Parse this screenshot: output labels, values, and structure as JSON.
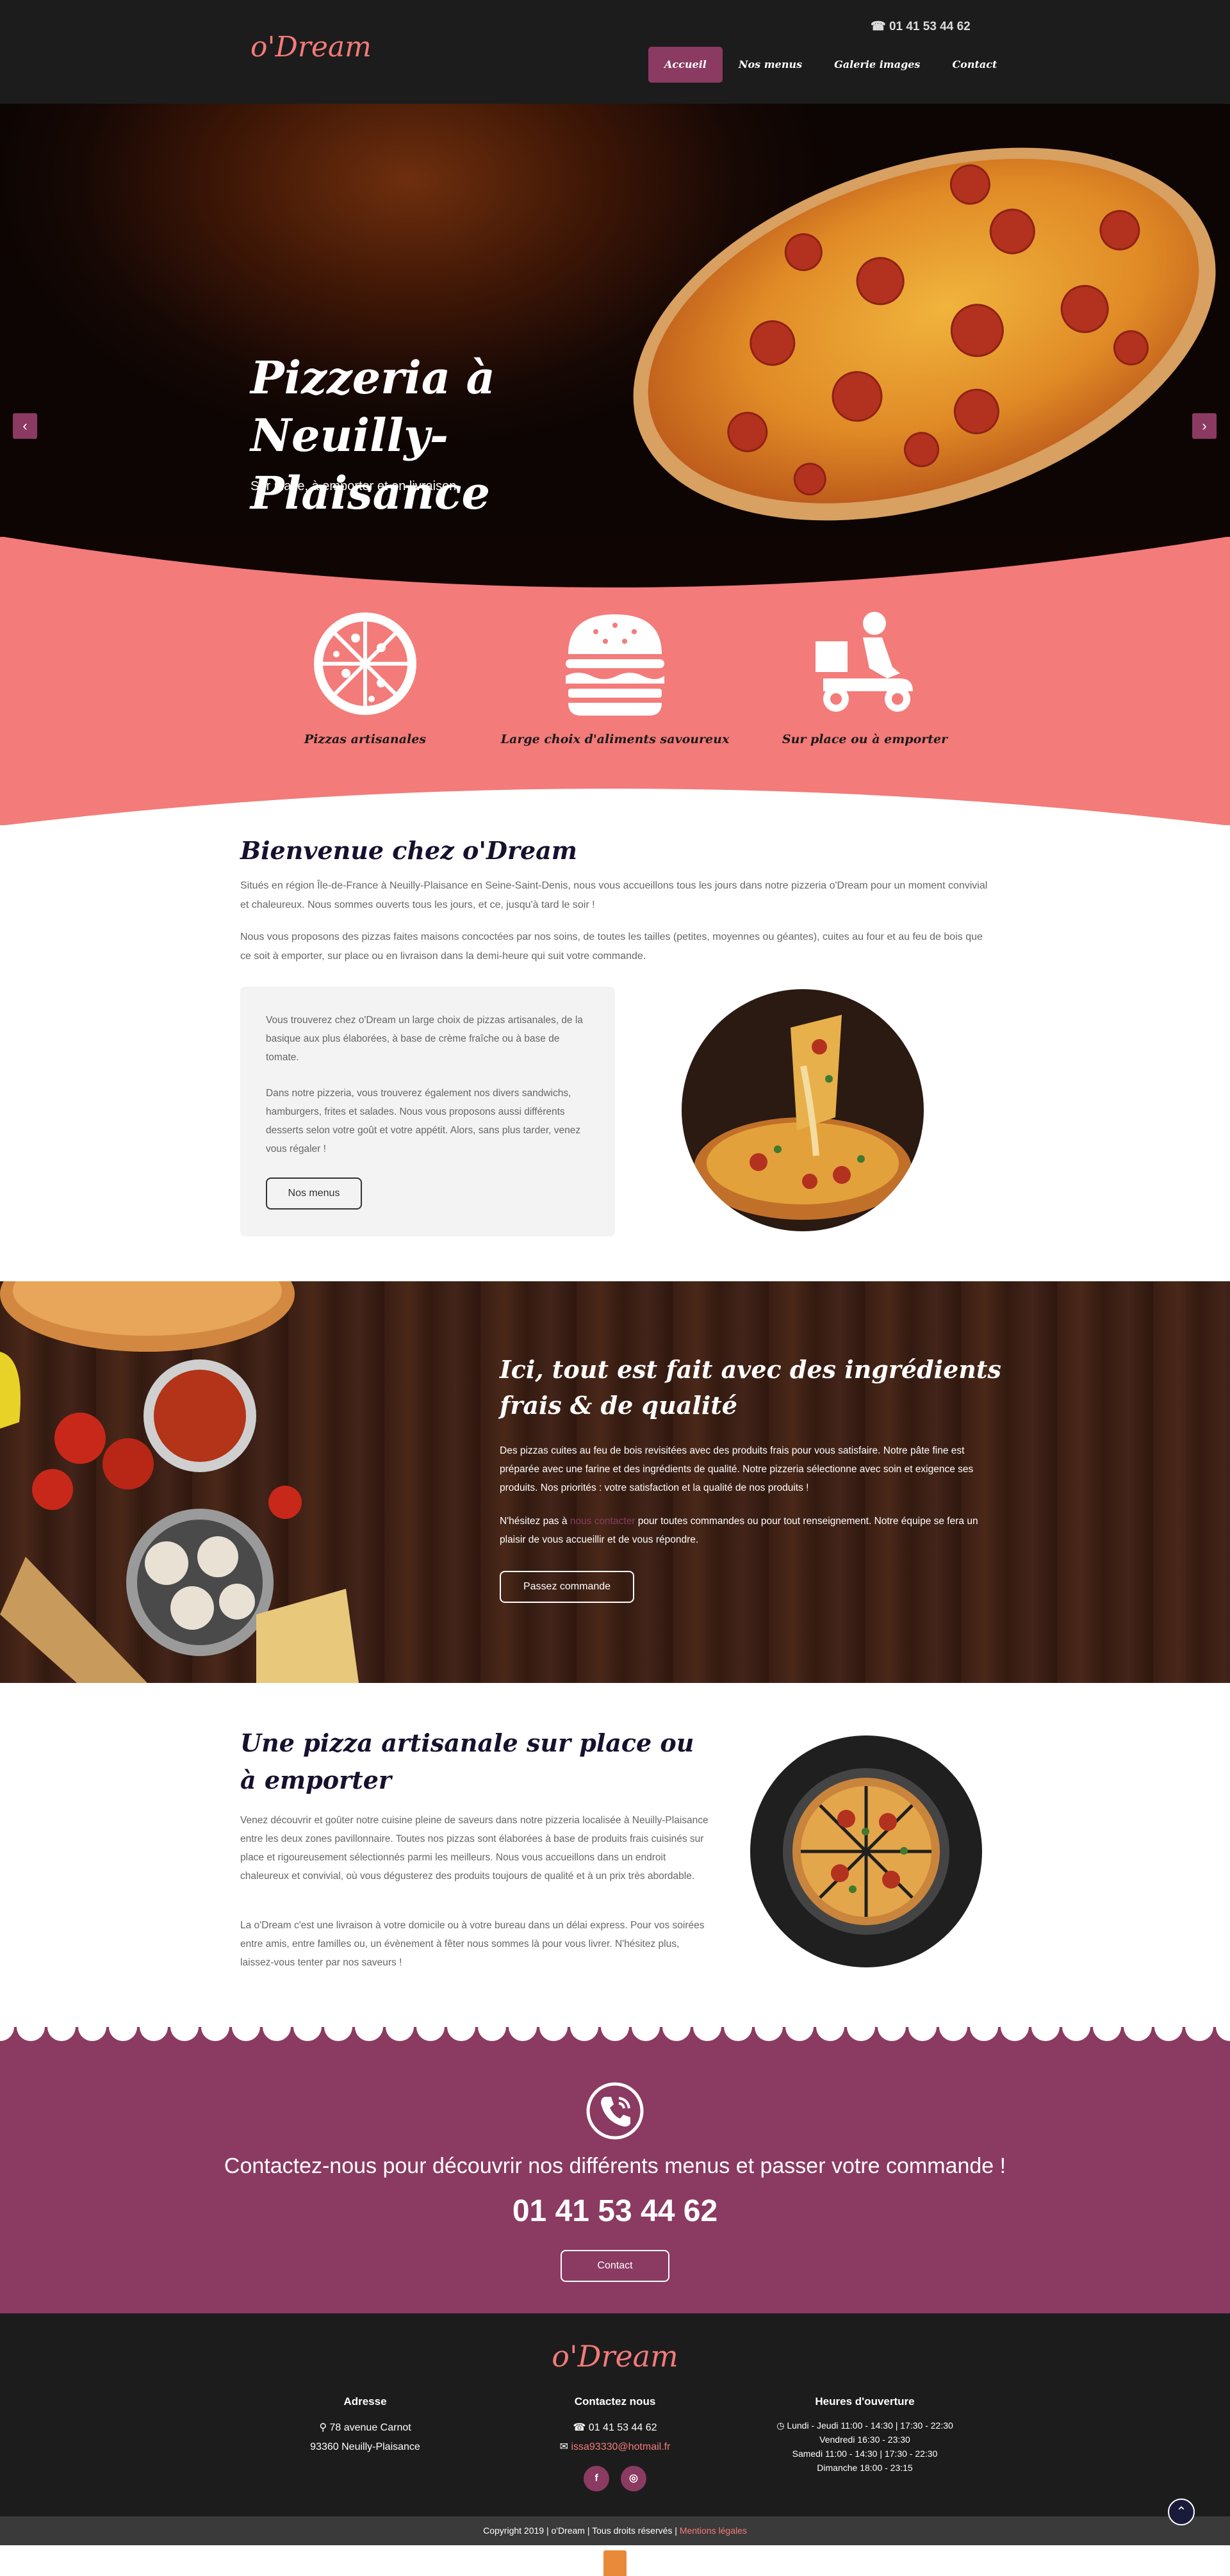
{
  "header": {
    "logo": "o'Dream",
    "phone": "☎ 01 41 53 44 62",
    "nav": [
      {
        "label": "Accueil",
        "active": true
      },
      {
        "label": "Nos menus",
        "active": false
      },
      {
        "label": "Galerie images",
        "active": false
      },
      {
        "label": "Contact",
        "active": false
      }
    ]
  },
  "hero": {
    "title": "Pizzeria à Neuilly-Plaisance",
    "subtitle": "Sur place, à emporter et en livraison",
    "prev": "‹",
    "next": "›"
  },
  "features": [
    {
      "label": "Pizzas artisanales",
      "icon": "pizza-icon"
    },
    {
      "label": "Large choix d'aliments savoureux",
      "icon": "burger-icon"
    },
    {
      "label": "Sur place ou à emporter",
      "icon": "delivery-scooter-icon"
    }
  ],
  "welcome": {
    "title": "Bienvenue chez o'Dream",
    "p1": "Situés en région Île-de-France à Neuilly-Plaisance en Seine-Saint-Denis, nous vous accueillons tous les jours dans notre pizzeria o'Dream pour un moment convivial et chaleureux. Nous sommes ouverts tous les jours, et ce, jusqu'à tard le soir !",
    "p2": "Nous vous proposons des pizzas faites maisons concoctées par nos soins, de toutes les tailles (petites, moyennes ou géantes), cuites au four et au feu de bois que ce soit à emporter, sur place ou en livraison dans la demi-heure qui suit votre commande.",
    "box_p1": "Vous trouverez chez o'Dream un large choix de pizzas artisanales, de la basique aux plus élaborées, à base de crème fraîche ou à base de tomate.",
    "box_p2": "Dans notre pizzeria, vous trouverez également nos divers sandwichs, hamburgers, frites et salades. Nous vous proposons aussi différents desserts selon votre goût et votre appétit. Alors, sans plus tarder, venez vous régaler !",
    "button": "Nos menus"
  },
  "ingredients": {
    "title": "Ici, tout est fait avec des ingrédients frais & de qualité",
    "p1": "Des pizzas cuites au feu de bois revisitées avec des produits frais pour vous satisfaire. Notre pâte fine est préparée avec une farine et des ingrédients de qualité. Notre pizzeria sélectionne avec soin et exigence ses produits. Nos priorités : votre satisfaction et la qualité de nos produits !",
    "p2_before": "N'hésitez pas à ",
    "p2_link": "nous contacter",
    "p2_after": " pour toutes commandes ou pour tout renseignement. Notre équipe se fera un plaisir de vous accueillir et de vous répondre.",
    "button": "Passez commande"
  },
  "artisanale": {
    "title": "Une pizza artisanale sur place ou à emporter",
    "p1": "Venez découvrir et goûter notre cuisine pleine de saveurs dans notre pizzeria localisée à Neuilly-Plaisance entre les deux zones pavillonnaire. Toutes nos pizzas sont élaborées à base de produits frais cuisinés sur place et rigoureusement sélectionnés parmi les meilleurs. Nous vous accueillons dans un endroit chaleureux et convivial, où vous dégusterez des produits toujours de qualité et à un prix très abordable.",
    "p2": "La o'Dream c'est une livraison à votre domicile ou à votre bureau dans un délai express. Pour vos soirées entre amis, entre familles ou, un évènement à fêter nous sommes là pour vous livrer. N'hésitez plus, laissez-vous tenter par nos saveurs !"
  },
  "contact": {
    "text": "Contactez-nous pour découvrir nos différents menus et passer votre commande !",
    "phone": "01 41 53 44 62",
    "button": "Contact"
  },
  "footer": {
    "logo": "o'Dream",
    "address": {
      "title": "Adresse",
      "line1": "78 avenue Carnot",
      "line2": "93360 Neuilly-Plaisance"
    },
    "contact": {
      "title": "Contactez nous",
      "phone": "01 41 53 44 62",
      "email": "issa93330@hotmail.fr",
      "facebook": "f",
      "instagram": "◎"
    },
    "hours": {
      "title": "Heures d'ouverture",
      "lines": [
        "Lundi - Jeudi 11:00 - 14:30 | 17:30 - 22:30",
        "Vendredi 16:30 - 23:30",
        "Samedi 11:00 - 14:30 | 17:30 - 22:30",
        "Dimanche 18:00 - 23:15"
      ]
    },
    "copyright": "Copyright 2019 | o'Dream | Tous droits réservés | ",
    "legal": "Mentions légales",
    "scroll_top": "⌃"
  },
  "colors": {
    "accent": "#8b3a62",
    "salmon": "#f37b79",
    "dark": "#1c1c1c"
  }
}
